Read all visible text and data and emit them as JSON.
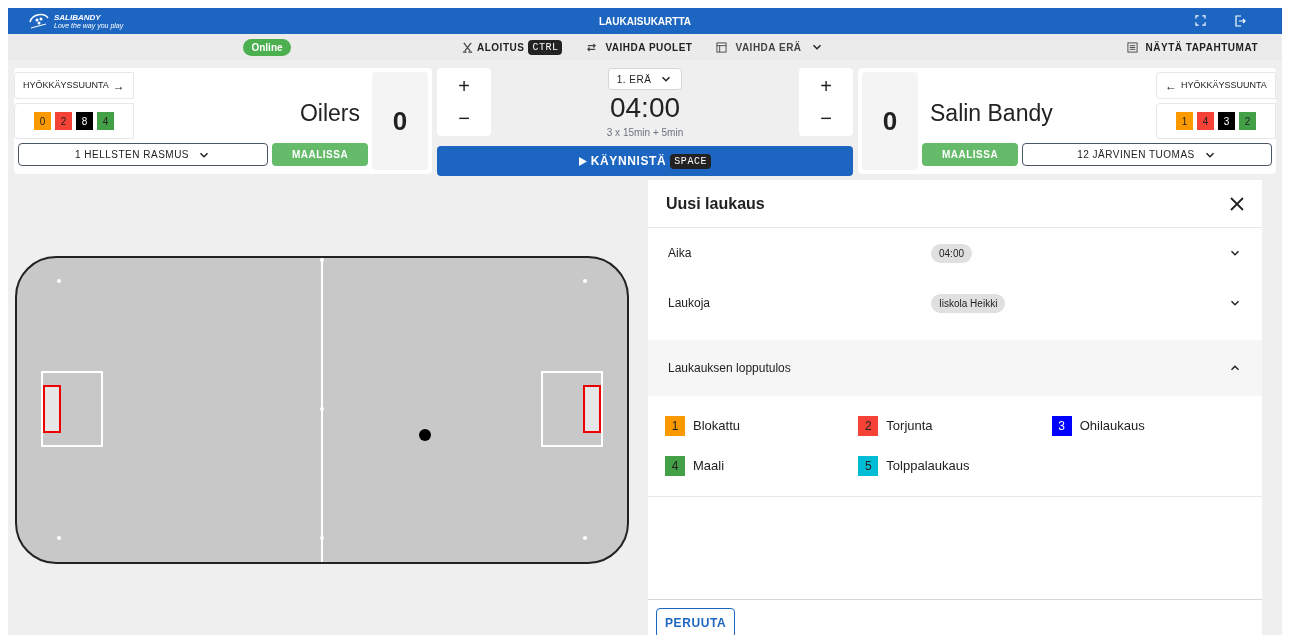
{
  "header": {
    "logo_text": "SALIBANDY",
    "logo_tagline": "Love the way you play",
    "title": "LAUKAISUKARTTA"
  },
  "toolbar": {
    "status": "Online",
    "online": true,
    "faceoff": "ALOITUS",
    "faceoff_key": "CTRL",
    "swap_sides": "VAIHDA PUOLET",
    "change_period": "VAIHDA ERÄ",
    "show_events": "NÄYTÄ TAPAHTUMAT"
  },
  "home": {
    "direction": "HYÖKKÄYSSUUNTA",
    "direction_arrow": "→",
    "name": "Oilers",
    "score": "0",
    "goalie": "1 HELLSTEN RASMUS",
    "goalie_button": "MAALISSA",
    "counters": [
      {
        "value": "0",
        "color": "#fb9a00"
      },
      {
        "value": "2",
        "color": "#f44336"
      },
      {
        "value": "8",
        "color": "#000000"
      },
      {
        "value": "4",
        "color": "#43a047"
      }
    ]
  },
  "clock": {
    "plus": "+",
    "minus": "−",
    "period": "1. ERÄ",
    "time": "04:00",
    "format": "3 x 15min + 5min",
    "start": "KÄYNNISTÄ",
    "start_key": "SPACE"
  },
  "away": {
    "direction": "HYÖKKÄYSSUUNTA",
    "direction_arrow": "←",
    "name": "Salin Bandy",
    "score": "0",
    "goalie": "12 JÄRVINEN TUOMAS",
    "goalie_button": "MAALISSA",
    "counters": [
      {
        "value": "1",
        "color": "#fb9a00"
      },
      {
        "value": "4",
        "color": "#f44336"
      },
      {
        "value": "3",
        "color": "#000000"
      },
      {
        "value": "2",
        "color": "#43a047"
      }
    ]
  },
  "panel": {
    "title": "Uusi laukaus",
    "fields": [
      {
        "label": "Aika",
        "value": "04:00",
        "expanded": false
      },
      {
        "label": "Laukoja",
        "value": "Iiskola Heikki",
        "expanded": false
      },
      {
        "label": "Laukauksen lopputulos",
        "expanded": true
      }
    ],
    "results": [
      {
        "number": "1",
        "label": "Blokattu",
        "color": "#fb9a00"
      },
      {
        "number": "2",
        "label": "Torjunta",
        "color": "#f44336"
      },
      {
        "number": "3",
        "label": "Ohilaukaus",
        "color": "#0000ff"
      },
      {
        "number": "4",
        "label": "Maali",
        "color": "#43a047"
      },
      {
        "number": "5",
        "label": "Tolppalaukaus",
        "color": "#00bcd4"
      }
    ],
    "cancel": "PERUUTA"
  }
}
